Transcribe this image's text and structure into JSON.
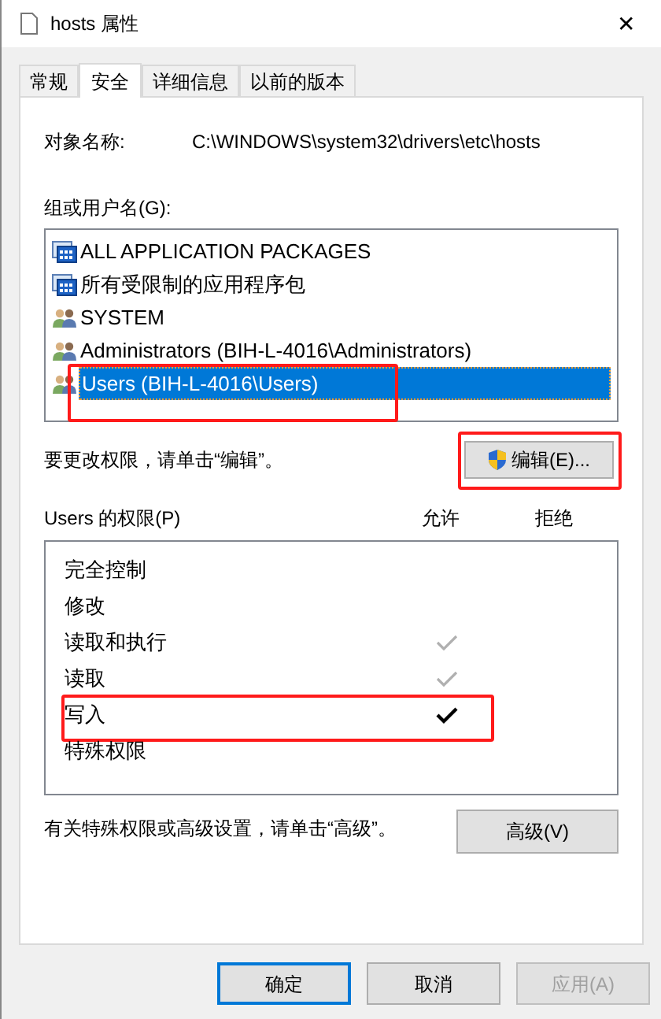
{
  "window": {
    "title": "hosts 属性",
    "close": "✕"
  },
  "tabs": [
    {
      "label": "常规",
      "selected": false
    },
    {
      "label": "安全",
      "selected": true
    },
    {
      "label": "详细信息",
      "selected": false
    },
    {
      "label": "以前的版本",
      "selected": false
    }
  ],
  "object_name": {
    "label": "对象名称:",
    "value": "C:\\WINDOWS\\system32\\drivers\\etc\\hosts"
  },
  "principals_label": "组或用户名(G):",
  "principals": [
    {
      "kind": "package",
      "name": "ALL APPLICATION PACKAGES",
      "selected": false,
      "highlighted": false
    },
    {
      "kind": "package",
      "name": "所有受限制的应用程序包",
      "selected": false,
      "highlighted": false
    },
    {
      "kind": "group",
      "name": "SYSTEM",
      "selected": false,
      "highlighted": false
    },
    {
      "kind": "group",
      "name": "Administrators (BIH-L-4016\\Administrators)",
      "selected": false,
      "highlighted": false
    },
    {
      "kind": "group",
      "name": "Users (BIH-L-4016\\Users)",
      "selected": true,
      "highlighted": true
    }
  ],
  "edit_hint": "要更改权限，请单击“编辑”。",
  "edit_button": {
    "label": "编辑(E)...",
    "highlighted": true
  },
  "permissions_label": "Users 的权限(P)",
  "columns": [
    "允许",
    "拒绝"
  ],
  "permissions": [
    {
      "name": "完全控制",
      "allowed": false,
      "highlighted": false
    },
    {
      "name": "修改",
      "allowed": false,
      "highlighted": false
    },
    {
      "name": "读取和执行",
      "allowed": true,
      "inherited": true,
      "highlighted": false
    },
    {
      "name": "读取",
      "allowed": true,
      "inherited": true,
      "highlighted": false
    },
    {
      "name": "写入",
      "allowed": true,
      "inherited": false,
      "highlighted": true
    },
    {
      "name": "特殊权限",
      "allowed": false,
      "highlighted": false
    }
  ],
  "advanced_hint": "有关特殊权限或高级设置，请单击“高级”。",
  "advanced_button": "高级(V)",
  "buttons": [
    {
      "label": "确定",
      "kind": "default"
    },
    {
      "label": "取消",
      "kind": "normal"
    },
    {
      "label": "应用(A)",
      "kind": "disabled"
    }
  ]
}
